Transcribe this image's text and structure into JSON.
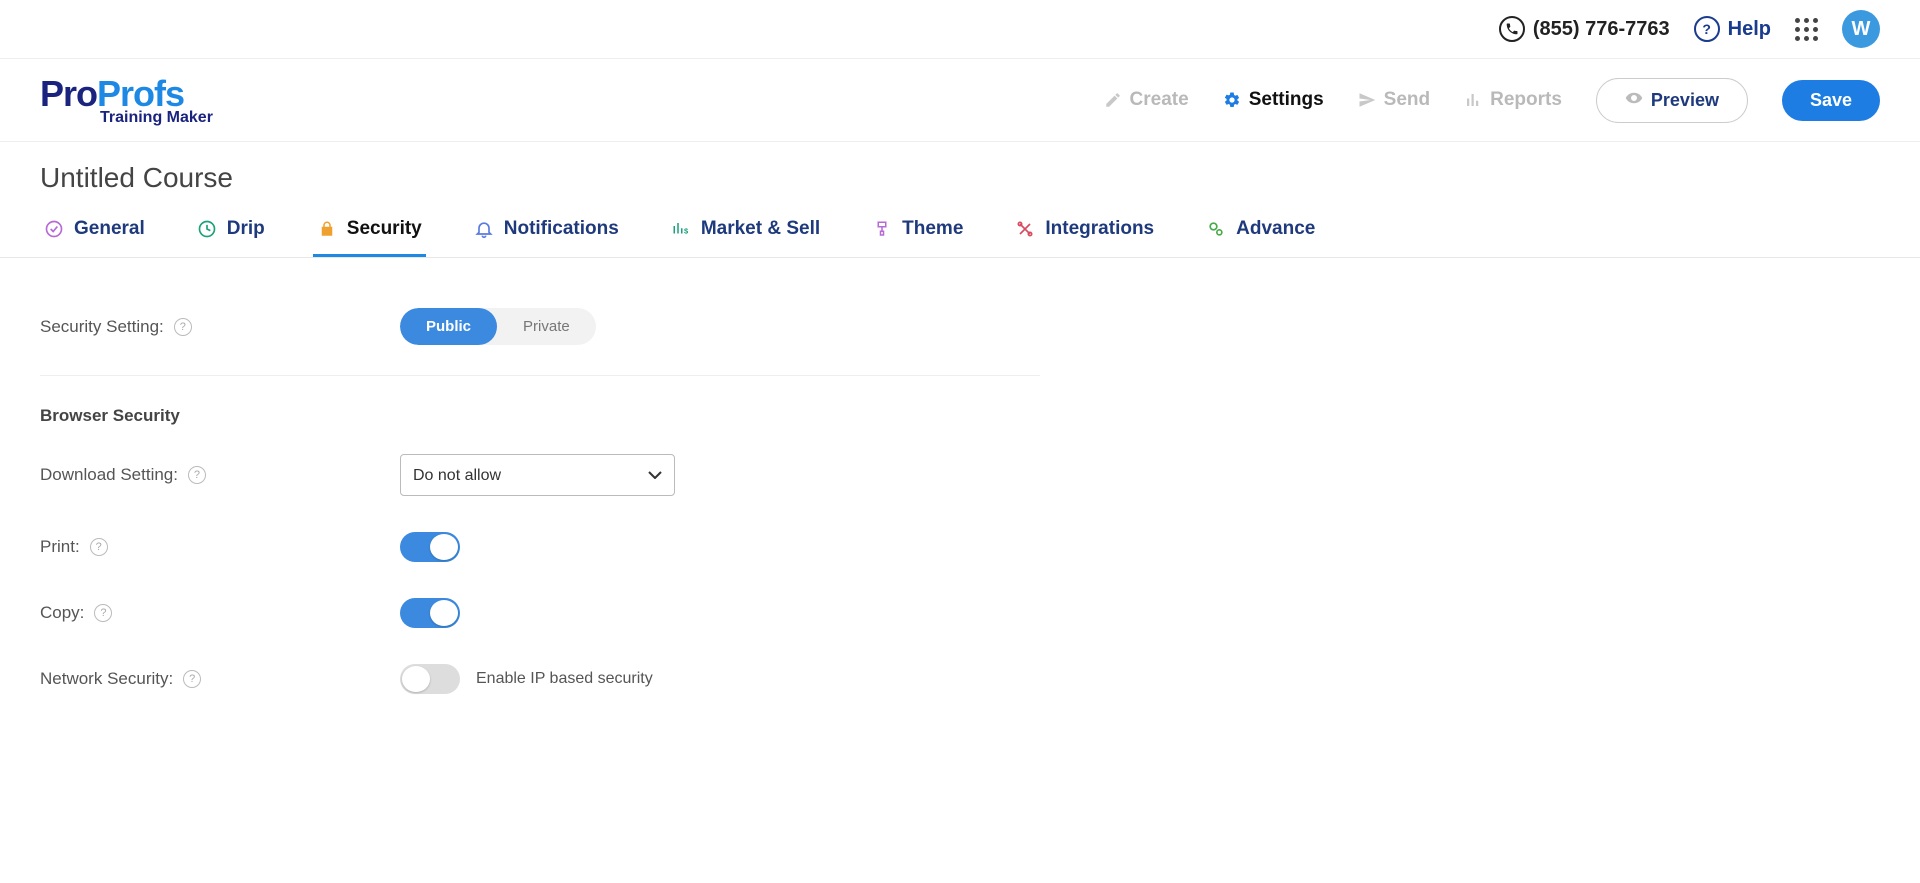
{
  "topbar": {
    "phone": "(855) 776-7763",
    "help": "Help",
    "avatar_initial": "W"
  },
  "logo": {
    "part1": "Pro",
    "part2": "Profs",
    "subtitle": "Training Maker"
  },
  "mainnav": {
    "create": "Create",
    "settings": "Settings",
    "send": "Send",
    "reports": "Reports",
    "preview": "Preview",
    "save": "Save"
  },
  "page": {
    "title": "Untitled Course"
  },
  "tabs": {
    "general": "General",
    "drip": "Drip",
    "security": "Security",
    "notifications": "Notifications",
    "market": "Market & Sell",
    "theme": "Theme",
    "integrations": "Integrations",
    "advance": "Advance"
  },
  "form": {
    "security_setting_label": "Security Setting:",
    "seg_public": "Public",
    "seg_private": "Private",
    "browser_security_header": "Browser Security",
    "download_setting_label": "Download Setting:",
    "download_setting_value": "Do not allow",
    "print_label": "Print:",
    "copy_label": "Copy:",
    "network_security_label": "Network Security:",
    "network_security_desc": "Enable IP based security",
    "print_on": true,
    "copy_on": true,
    "network_on": false
  }
}
